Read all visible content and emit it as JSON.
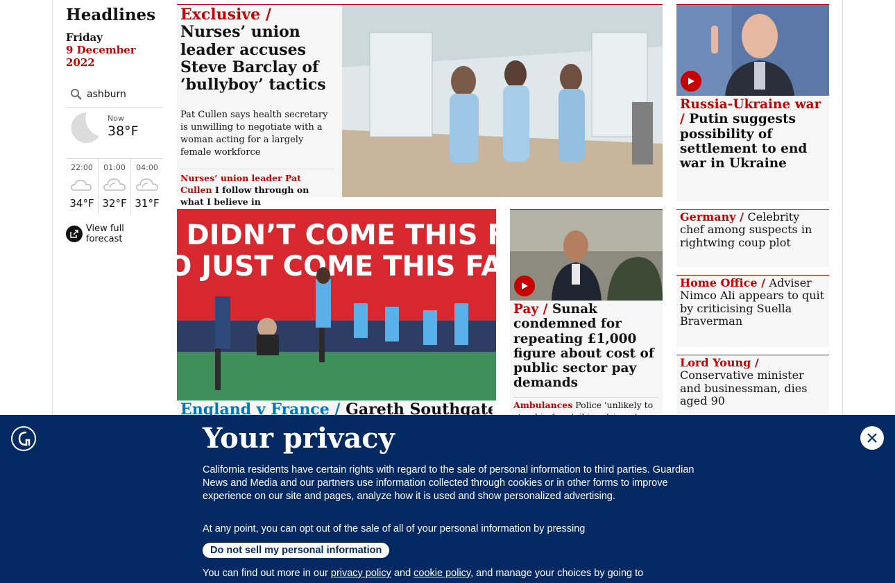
{
  "sidebar": {
    "heading": "Headlines",
    "day": "Friday",
    "date": "9 December 2022",
    "location": "ashburn",
    "now_label": "Now",
    "now_temp": "38°F",
    "forecast": [
      {
        "time": "22:00",
        "temp": "34°F"
      },
      {
        "time": "01:00",
        "temp": "32°F"
      },
      {
        "time": "04:00",
        "temp": "31°F"
      }
    ],
    "full_forecast": "View full forecast"
  },
  "main_story": {
    "kicker": "Exclusive /",
    "headline": "Nurses’ union leader accuses Steve Barclay of ‘bullyboy’ tactics",
    "standfirst": "Pat Cullen says health secretary is unwilling to negotiate with a woman acting for a largely female workforce",
    "related_kicker": "Nurses’ union leader Pat Cullen",
    "related_text": "I follow through on what I believe in"
  },
  "russia_story": {
    "kicker": "Russia-Ukraine war /",
    "headline": "Putin suggests possibility of settlement to end war in Ukraine"
  },
  "side_stories": [
    {
      "kicker": "Germany /",
      "headline": "Celebrity chef among suspects in rightwing coup plot"
    },
    {
      "kicker": "Home Office /",
      "headline": "Adviser Nimco Ali appears to quit by criticising Suella Braverman"
    },
    {
      "kicker": "Lord Young /",
      "headline": "Conservative minister and businessman, dies aged 90"
    }
  ],
  "england_story": {
    "kicker": "England v France /",
    "headline": "Gareth Southgate",
    "banner_text_line1": "WE DIDN’T COME THIS FAR",
    "banner_text_line2": "TO JUST COME THIS FAR"
  },
  "pay_story": {
    "kicker": "Pay /",
    "headline": "Sunak condemned for repeating £1,000 figure about cost of public sector pay demands",
    "related_kicker": "Ambulances",
    "related_text": "Police 'unlikely to stand in for striking drivers'"
  },
  "cookie_banner": {
    "title": "Your privacy",
    "paragraph1": "California residents have certain rights with regard to the sale of personal information to third parties. Guardian News and Media and our partners use information collected through cookies or in other forms to improve experience on our site and pages, analyze how it is used and show personalized advertising.",
    "paragraph2": "At any point, you can opt out of the sale of all of your personal information by pressing",
    "dns_button": "Do not sell my personal information",
    "p3_start": "You can find out more in our",
    "privacy_link": "privacy policy",
    "and": "and",
    "cookie_link": "cookie policy",
    "p3_end": ", and manage your choices by going to"
  },
  "colors": {
    "brand_navy": "#052962",
    "news_red": "#c70000",
    "sport_blue": "#0077b6"
  }
}
